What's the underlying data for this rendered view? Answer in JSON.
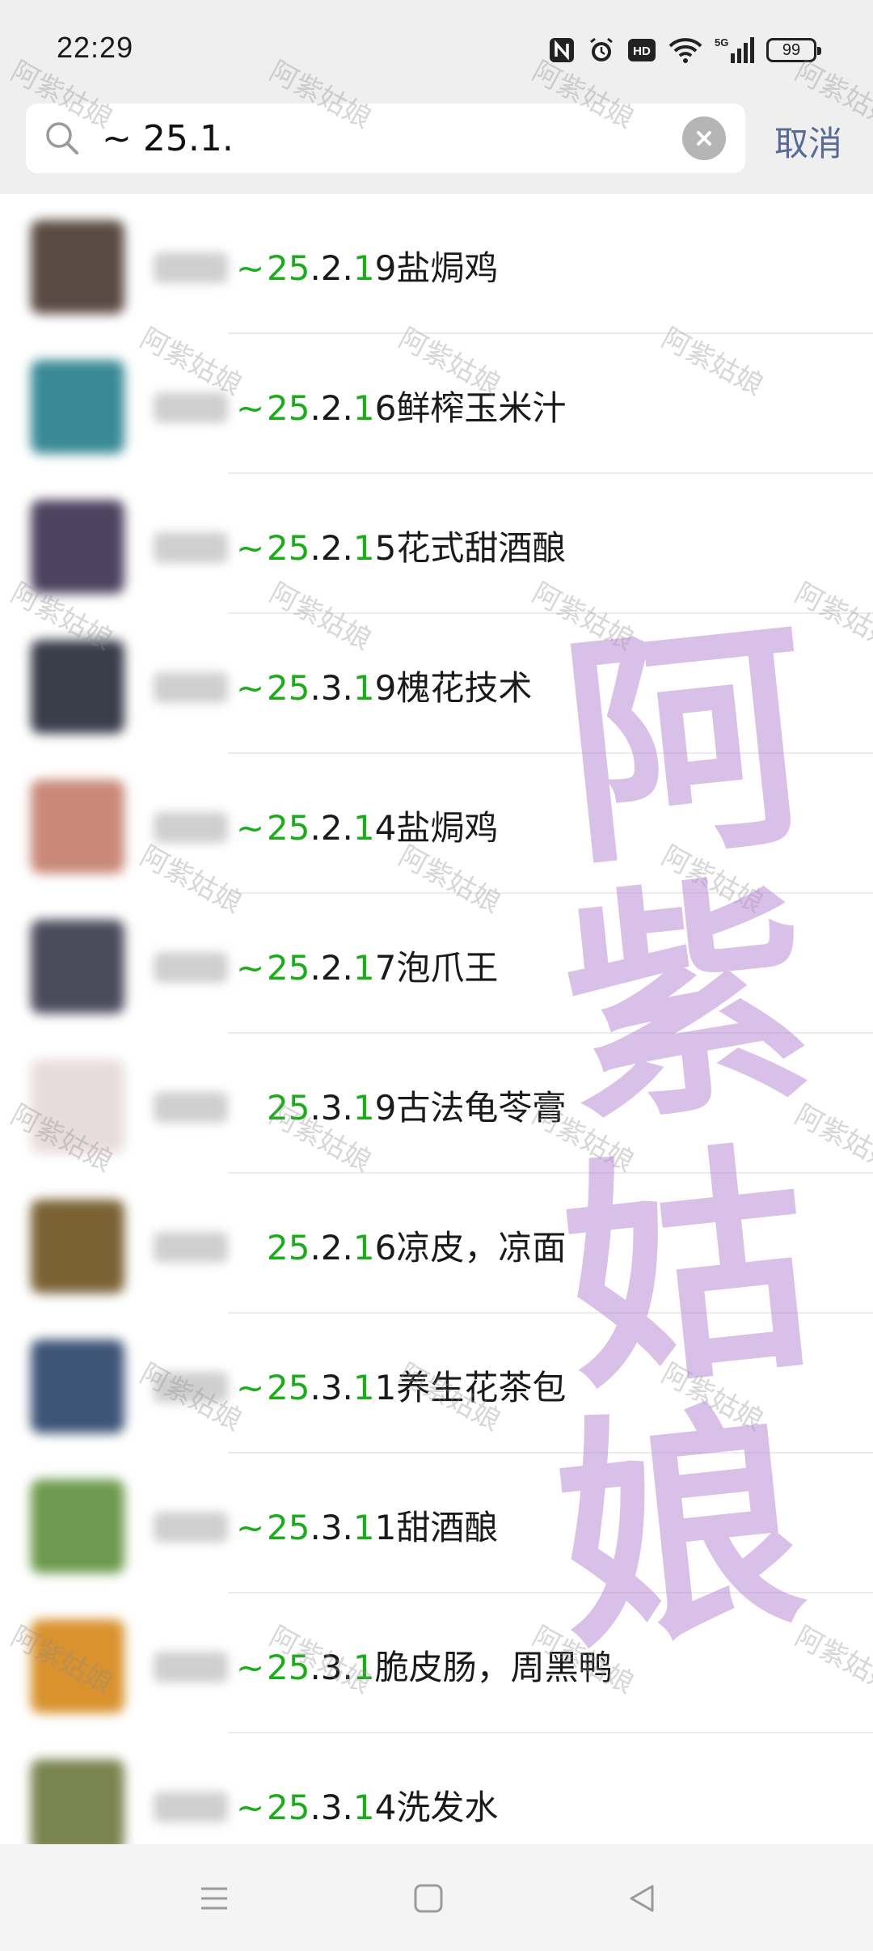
{
  "status_bar": {
    "time": "22:29",
    "icons": [
      "nfc-icon",
      "alarm-icon",
      "hd-icon",
      "wifi-icon",
      "5g-signal-icon"
    ],
    "battery": "99"
  },
  "search": {
    "query": "~ 25.1.",
    "cancel_label": "取消"
  },
  "results": [
    {
      "prefix": "~ ",
      "hl1": "25",
      "mid": ".2.",
      "hl2": "1",
      "rest": "9盐焗鸡",
      "avatar_color": "#5a4a44"
    },
    {
      "prefix": "~ ",
      "hl1": "25",
      "mid": ".2.",
      "hl2": "1",
      "rest": "6鲜榨玉米汁",
      "avatar_color": "#3a8a96"
    },
    {
      "prefix": "~ ",
      "hl1": "25",
      "mid": ".2.",
      "hl2": "1",
      "rest": "5花式甜酒酿",
      "avatar_color": "#4d4360"
    },
    {
      "prefix": "~ ",
      "hl1": "25",
      "mid": ".3.",
      "hl2": "1",
      "rest": "9槐花技术",
      "avatar_color": "#3a3d4a"
    },
    {
      "prefix": "~ ",
      "hl1": "25",
      "mid": ".2.",
      "hl2": "1",
      "rest": "4盐焗鸡",
      "avatar_color": "#c98878"
    },
    {
      "prefix": "~ ",
      "hl1": "25",
      "mid": ".2.",
      "hl2": "1",
      "rest": "7泡爪王",
      "avatar_color": "#4b4b5c"
    },
    {
      "prefix": "",
      "hl1": "25",
      "mid": ".3.",
      "hl2": "1",
      "rest": "9古法龟苓膏",
      "avatar_color": "#e7dcdc"
    },
    {
      "prefix": "",
      "hl1": "25",
      "mid": ".2.",
      "hl2": "1",
      "rest": "6凉皮，凉面",
      "avatar_color": "#7a6234"
    },
    {
      "prefix": "~ ",
      "hl1": "25",
      "mid": ".3.",
      "hl2": "1",
      "rest": "1养生花茶包",
      "avatar_color": "#3e5577"
    },
    {
      "prefix": "~ ",
      "hl1": "25",
      "mid": ".3.",
      "hl2": "1",
      "rest": "1甜酒酿",
      "avatar_color": "#6c9a4e"
    },
    {
      "prefix": "~ ",
      "hl1": "25",
      "mid": ".3.",
      "hl2": "1",
      "rest": "脆皮肠，周黑鸭",
      "avatar_color": "#d9922e"
    },
    {
      "prefix": "~ ",
      "hl1": "25",
      "mid": ".3.",
      "hl2": "1",
      "rest": "4洗发水",
      "avatar_color": "#7a8450"
    }
  ],
  "watermark": {
    "small": "阿紫姑娘",
    "big": [
      "阿",
      "紫",
      "姑",
      "娘"
    ]
  },
  "colors": {
    "highlight": "#1aad19",
    "cancel": "#576b95",
    "watermark_big": "#b98cd7"
  }
}
